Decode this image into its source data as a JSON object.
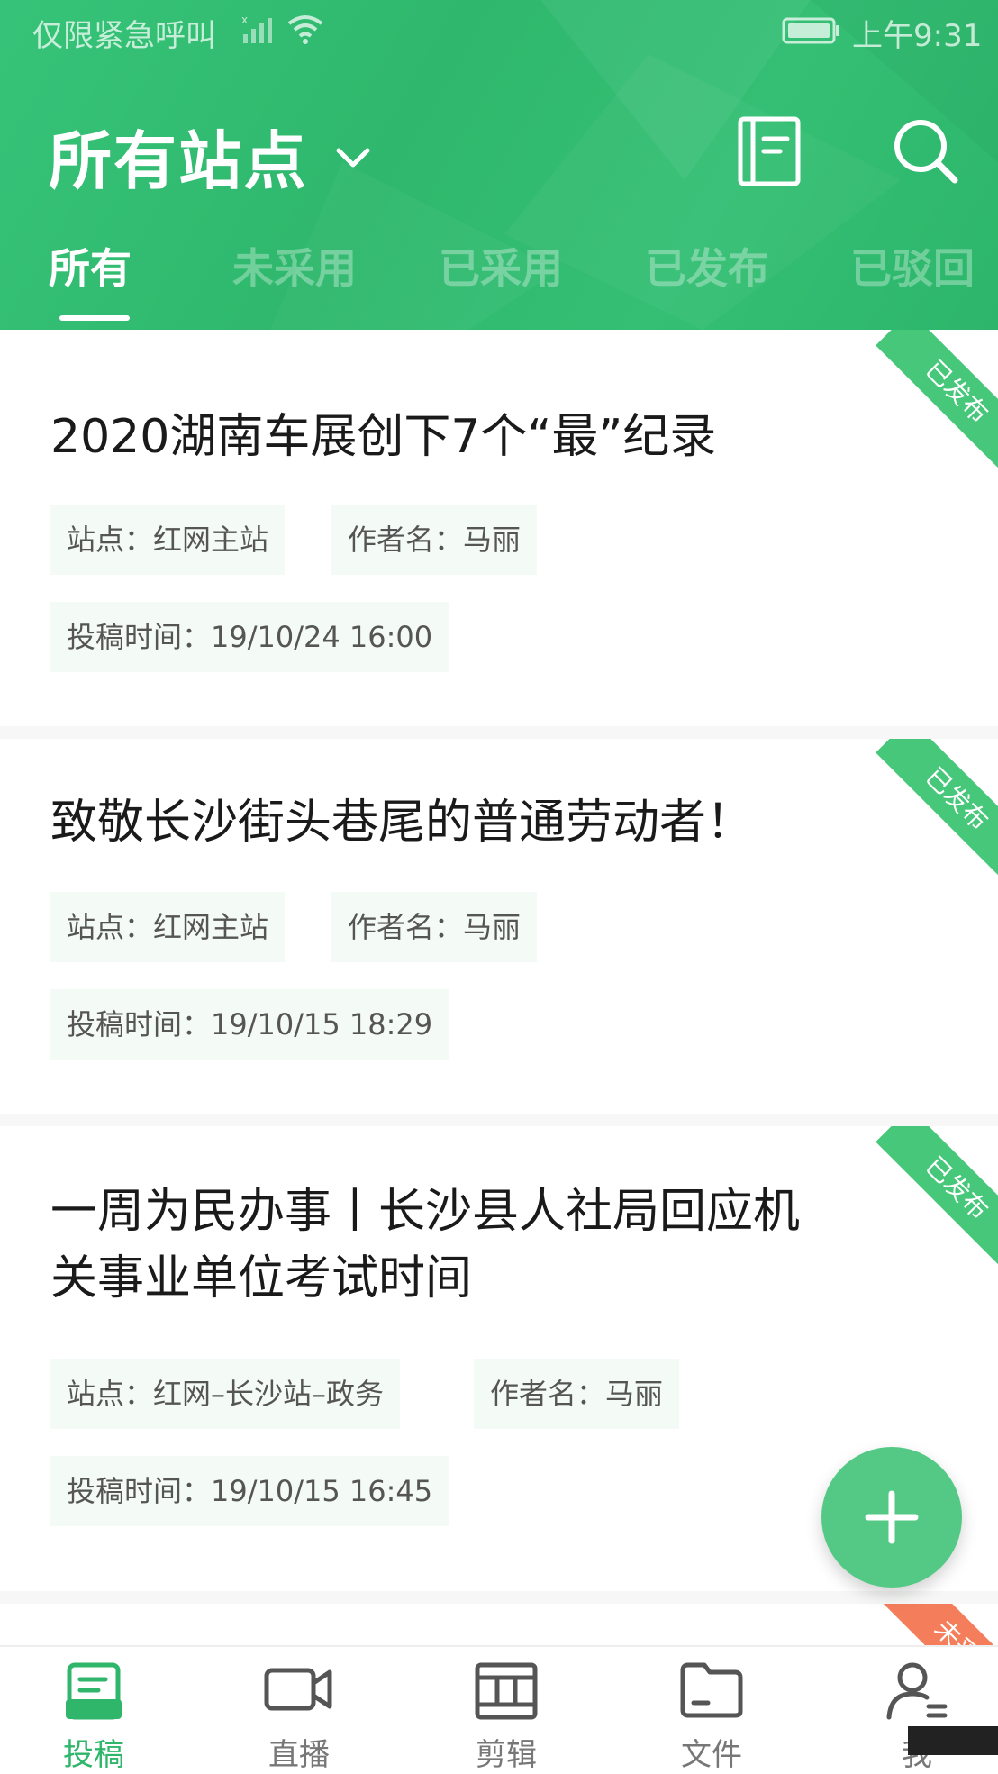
{
  "status_bar": {
    "carrier": "仅限紧急呼叫",
    "time": "上午9:31"
  },
  "header": {
    "title": "所有站点",
    "book_icon": "notebook-icon",
    "search_icon": "search-icon",
    "chevron_icon": "chevron-down-icon"
  },
  "tabs": [
    {
      "label": "所有",
      "active": true
    },
    {
      "label": "未采用",
      "active": false
    },
    {
      "label": "已采用",
      "active": false
    },
    {
      "label": "已发布",
      "active": false
    },
    {
      "label": "已驳回",
      "active": false
    }
  ],
  "articles": [
    {
      "title": "2020湖南车展创下7个“最”纪录",
      "site_label": "站点：",
      "site": "红网主站",
      "author_label": "作者名：",
      "author": "马丽",
      "time_label": "投稿时间：",
      "time": "19/10/24 16:00",
      "status": "已发布"
    },
    {
      "title": "致敬长沙街头巷尾的普通劳动者！",
      "site_label": "站点：",
      "site": "红网主站",
      "author_label": "作者名：",
      "author": "马丽",
      "time_label": "投稿时间：",
      "time": "19/10/15 18:29",
      "status": "已发布"
    },
    {
      "title": "一周为民办事丨长沙县人社局回应机关事业单位考试时间",
      "site_label": "站点：",
      "site": "红网–长沙站–政务",
      "author_label": "作者名：",
      "author": "马丽",
      "time_label": "投稿时间：",
      "time": "19/10/15 16:45",
      "status": "已发布"
    },
    {
      "status": "未采"
    }
  ],
  "fab": {
    "icon": "plus-icon"
  },
  "bottom_nav": [
    {
      "label": "投稿",
      "icon": "document-edit-icon",
      "active": true
    },
    {
      "label": "直播",
      "icon": "video-camera-icon",
      "active": false
    },
    {
      "label": "剪辑",
      "icon": "film-edit-icon",
      "active": false
    },
    {
      "label": "文件",
      "icon": "folder-icon",
      "active": false
    },
    {
      "label": "我",
      "icon": "user-icon",
      "active": false
    }
  ],
  "colors": {
    "brand_green": "#34bf74",
    "ribbon_green": "#47c77a",
    "ribbon_orange": "#f47e5b",
    "chip_bg": "#f4faf6"
  }
}
